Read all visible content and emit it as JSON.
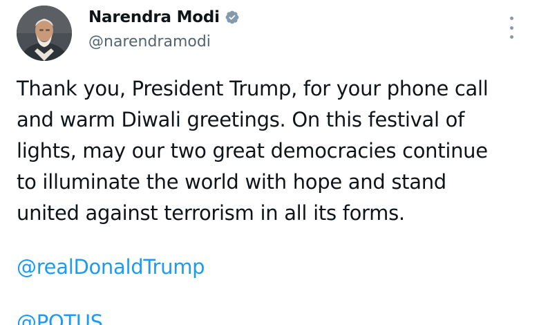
{
  "author": {
    "display_name": "Narendra Modi",
    "handle": "@narendramodi",
    "verified": true,
    "avatar_icon": "profile-photo",
    "verified_icon": "verified-badge-icon"
  },
  "menu": {
    "icon": "more-options-icon"
  },
  "tweet": {
    "text": "Thank you, President Trump, for your phone call\nand warm Diwali greetings. On this festival of\nlights, may our two great democracies continue\nto illuminate the world with hope and stand\nunited against terrorism in all its forms.",
    "mentions": [
      "@realDonaldTrump",
      "@POTUS"
    ]
  },
  "colors": {
    "link": "#1d9bf0",
    "secondary_text": "#536471",
    "verified_badge": "#829aab"
  }
}
